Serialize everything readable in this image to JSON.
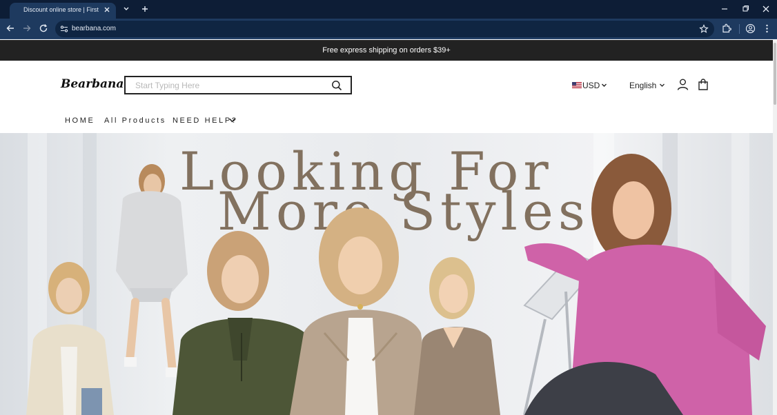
{
  "browser": {
    "tab_title": "Discount online store | First Ch",
    "url": "bearbana.com"
  },
  "announcement": "Free express shipping on orders $39+",
  "header": {
    "logo": "Bearbana",
    "search_placeholder": "Start Typing Here",
    "currency": "USD",
    "language": "English"
  },
  "nav": {
    "items": [
      "HOME",
      "All Products",
      "NEED HELP?"
    ]
  },
  "hero": {
    "line1": "Looking For",
    "line2": "More  Styles"
  },
  "colors": {
    "tabstrip": "#0d1d36",
    "toolbar": "#1e3a5f",
    "announce_bg": "#222222",
    "hero_text": "#82715f",
    "pink_sweater": "#cf62a8",
    "olive_hoodie": "#4d5637",
    "tan_jacket": "#b8a48f"
  },
  "icons": [
    "back-icon",
    "forward-icon",
    "reload-icon",
    "site-info-icon",
    "star-icon",
    "extensions-icon",
    "profile-icon",
    "menu-icon",
    "search-icon",
    "us-flag-icon",
    "chevron-down-icon",
    "account-icon",
    "cart-icon"
  ]
}
